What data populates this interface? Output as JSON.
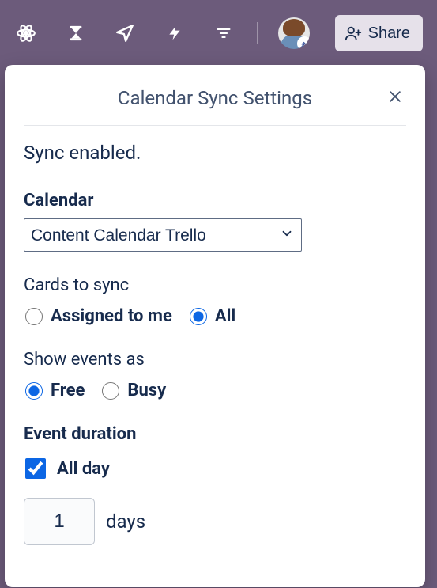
{
  "topbar": {
    "share_label": "Share"
  },
  "panel": {
    "title": "Calendar Sync Settings",
    "status": "Sync enabled.",
    "calendar_label": "Calendar",
    "calendar_selected": "Content Calendar Trello",
    "cards_label": "Cards to sync",
    "cards_options": {
      "assigned": "Assigned to me",
      "all": "All"
    },
    "cards_selected": "all",
    "show_label": "Show events as",
    "show_options": {
      "free": "Free",
      "busy": "Busy"
    },
    "show_selected": "free",
    "duration_label": "Event duration",
    "all_day_label": "All day",
    "all_day_checked": true,
    "duration_value": "1",
    "duration_unit": "days"
  }
}
